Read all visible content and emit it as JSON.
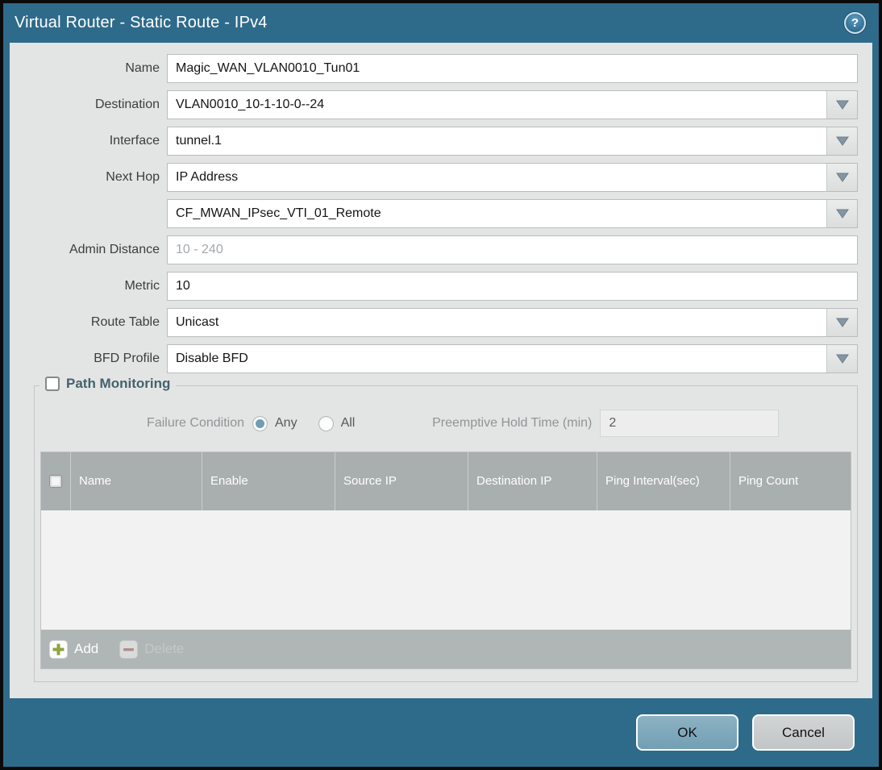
{
  "window": {
    "title": "Virtual Router - Static Route - IPv4",
    "help_glyph": "?"
  },
  "form": {
    "rows": [
      {
        "label": "Name",
        "value": "Magic_WAN_VLAN0010_Tun01"
      },
      {
        "label": "Destination",
        "value": "VLAN0010_10-1-10-0--24"
      },
      {
        "label": "Interface",
        "value": "tunnel.1"
      },
      {
        "label": "Next Hop",
        "value": "IP Address"
      },
      {
        "label": "",
        "value": "CF_MWAN_IPsec_VTI_01_Remote"
      },
      {
        "label": "Admin Distance",
        "placeholder": "10 - 240"
      },
      {
        "label": "Metric",
        "value": "10"
      },
      {
        "label": "Route Table",
        "value": "Unicast"
      },
      {
        "label": "BFD Profile",
        "value": "Disable BFD"
      }
    ]
  },
  "path_monitoring": {
    "title": "Path Monitoring",
    "checkbox_checked": false,
    "failure_condition": {
      "label": "Failure Condition",
      "options": [
        {
          "label": "Any",
          "selected": true
        },
        {
          "label": "All",
          "selected": false
        }
      ]
    },
    "preemptive_hold_time": {
      "label": "Preemptive Hold Time (min)",
      "value": "2"
    },
    "table": {
      "columns": [
        "Name",
        "Enable",
        "Source IP",
        "Destination IP",
        "Ping Interval(sec)",
        "Ping Count"
      ],
      "rows": []
    },
    "buttons": {
      "add": "Add",
      "delete": "Delete",
      "delete_enabled": false
    }
  },
  "footer": {
    "ok": "OK",
    "cancel": "Cancel"
  },
  "colors": {
    "titlebar": "#2e6b8b",
    "content_bg": "#e3e5e4",
    "table_header_bg": "#a9aeae",
    "table_footer_bg": "#b0b5b5",
    "ok_button": "#7fa8bb",
    "radio_selected": "#6f9db3",
    "add_icon_green": "#92a93e",
    "delete_icon_red": "#b06f68"
  }
}
